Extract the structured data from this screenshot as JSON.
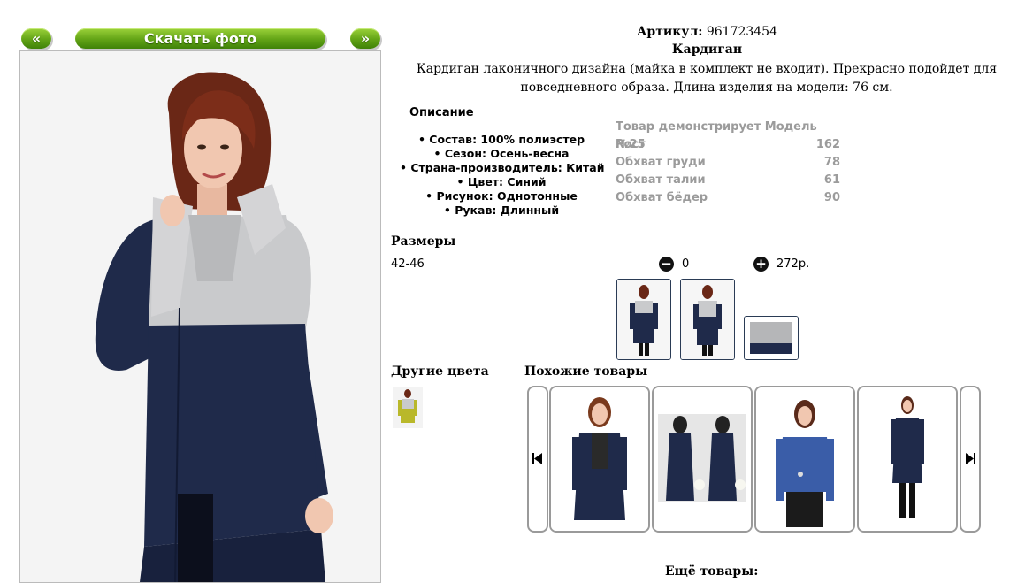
{
  "nav": {
    "prev_label": "«",
    "download_label": "Скачать фото",
    "next_label": "»"
  },
  "product": {
    "article_label": "Артикул:",
    "article_value": "961723454",
    "name": "Кардиган",
    "description": "Кардиган лаконичного дизайна (майка в комплект не входит). Прекрасно подойдет для повседневного образа. Длина изделия на модели: 76 см."
  },
  "description_block": {
    "heading": "Описание",
    "items": [
      "• Состав: 100% полиэстер",
      "• Сезон: Осень-весна",
      "• Страна-производитель: Китай",
      "• Цвет: Синий",
      "• Рисунок: Однотонные",
      "• Рукав: Длинный"
    ]
  },
  "model": {
    "title": "Товар демонстрирует Модель №25",
    "rows": [
      {
        "label": "Рост",
        "value": "162"
      },
      {
        "label": "Обхват груди",
        "value": "78"
      },
      {
        "label": "Обхват талии",
        "value": "61"
      },
      {
        "label": "Обхват бёдер",
        "value": "90"
      }
    ]
  },
  "sizes": {
    "heading": "Размеры",
    "value": "42-46",
    "quantity": "0",
    "price": "272р."
  },
  "sections": {
    "other_colors": "Другие цвета",
    "similar": "Похожие товары",
    "more": "Ещё товары:"
  },
  "colors": {
    "accent_green": "#62a316",
    "cardigan_navy": "#1f2a4a",
    "cardigan_grey": "#c9cacc",
    "border_grey": "#9a9a9a"
  },
  "icons": {
    "minus": "minus-circle-icon",
    "plus": "plus-circle-icon",
    "carousel_prev": "skip-back-icon",
    "carousel_next": "skip-forward-icon"
  }
}
